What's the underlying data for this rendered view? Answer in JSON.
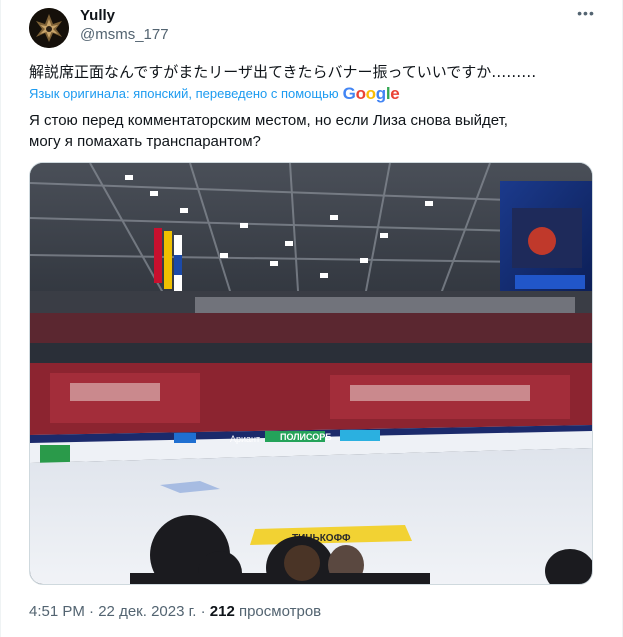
{
  "author": {
    "display_name": "Yully",
    "handle": "@msms_177"
  },
  "tweet": {
    "original_text": "解説席正面なんですがまたリーザ出てきたらバナー振っていいですか………",
    "translation_note": "Язык оригинала: японский, переведено с помощью",
    "translation_provider": "Google",
    "translated_text_line1": "Я стою перед комментаторским местом, но если Лиза снова выйдет,",
    "translated_text_line2": "могу я помахать транспарантом?",
    "time": "4:51 PM",
    "date": "22 дек. 2023 г.",
    "separator": "·",
    "views_count": "212",
    "views_label": "просмотров"
  },
  "media": {
    "board_ads": [
      "Ариант",
      "ПОЛИСОРБ",
      "ТИНЬКОФФ"
    ]
  },
  "icons": {
    "more": "more-icon"
  },
  "colors": {
    "accent": "#1d9bf0",
    "secondary_text": "#536471",
    "primary_text": "#0f1419"
  }
}
